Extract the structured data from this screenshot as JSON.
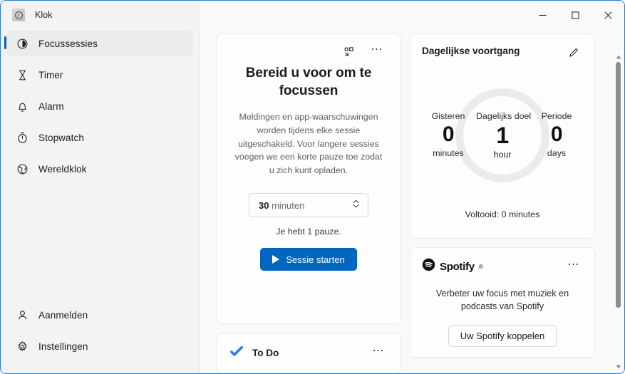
{
  "window": {
    "app_icon": "clock-icon",
    "title": "Klok",
    "minimize_label": "Minimaliseren",
    "maximize_label": "Maximaliseren",
    "close_label": "Sluiten"
  },
  "sidebar": {
    "items": [
      {
        "label": "Focussessies",
        "icon": "focus-icon",
        "selected": true
      },
      {
        "label": "Timer",
        "icon": "hourglass-icon",
        "selected": false
      },
      {
        "label": "Alarm",
        "icon": "bell-icon",
        "selected": false
      },
      {
        "label": "Stopwatch",
        "icon": "stopwatch-icon",
        "selected": false
      },
      {
        "label": "Wereldklok",
        "icon": "globe-icon",
        "selected": false
      }
    ],
    "bottom_items": [
      {
        "label": "Aanmelden",
        "icon": "person-icon"
      },
      {
        "label": "Instellingen",
        "icon": "gear-icon"
      }
    ]
  },
  "focus_card": {
    "popout_icon": "pop-out-icon",
    "more_icon": "more-options-icon",
    "title": "Bereid u voor om te focussen",
    "description": "Meldingen en app-waarschuwingen worden tijdens elke sessie uitgeschakeld. Voor langere sessies voegen we een korte pauze toe zodat u zich kunt opladen.",
    "duration_value": "30",
    "duration_unit": "minuten",
    "spinner_icon": "chevron-updown-icon",
    "pause_note": "Je hebt 1 pauze.",
    "start_button": "Sessie starten",
    "start_button_color": "#0067c0",
    "play_icon": "play-icon"
  },
  "todo_card": {
    "icon": "todo-check-icon",
    "label": "To Do",
    "more_icon": "more-options-icon",
    "accent": "#2680eb"
  },
  "progress_card": {
    "title": "Dagelijkse voortgang",
    "edit_icon": "pencil-icon",
    "ring_color": "#ebebeb",
    "stats": [
      {
        "label": "Gisteren",
        "value": "0",
        "unit": "minutes"
      },
      {
        "label": "Dagelijks doel",
        "value": "1",
        "unit": "hour"
      },
      {
        "label": "Periode",
        "value": "0",
        "unit": "days"
      }
    ],
    "completed": "Voltooid: 0 minutes"
  },
  "spotify_card": {
    "logo_icon": "spotify-logo-icon",
    "brand": "Spotify",
    "trademark": "®",
    "more_icon": "more-options-icon",
    "description": "Verbeter uw focus met muziek en podcasts van Spotify",
    "button": "Uw Spotify koppelen"
  },
  "scrollbar": {
    "up_icon": "scroll-up-arrow-icon",
    "down_icon": "scroll-down-arrow-icon"
  }
}
